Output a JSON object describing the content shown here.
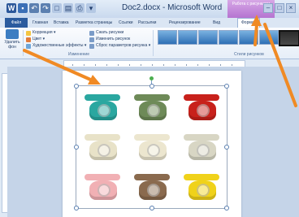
{
  "titlebar": {
    "title": "Doc2.docx - Microsoft Word",
    "context_group": "Работа с рисунками",
    "window_buttons": [
      "–",
      "□",
      "×"
    ]
  },
  "tabs": [
    "Файл",
    "Главная",
    "Вставка",
    "Разметка страницы",
    "Ссылки",
    "Рассылки",
    "Рецензирование",
    "Вид",
    "Формат"
  ],
  "ribbon": {
    "remove_bg_label": "Удалить фон",
    "adjust": {
      "corrections": "Коррекция",
      "color": "Цвет",
      "artistic": "Художественные эффекты",
      "compress": "Сжать рисунки",
      "change": "Изменить рисунок",
      "reset": "Сброс параметров рисунка",
      "group_label": "Изменение"
    },
    "styles": {
      "group_label": "Стили рисунков"
    }
  },
  "colors": {
    "file_tab": "#2b5b9e",
    "context_group": "#b574d1",
    "arrow": "#f08a24",
    "rotate_handle": "#4caf50"
  },
  "phones": [
    {
      "color": "#2aa7a0"
    },
    {
      "color": "#6e8a58"
    },
    {
      "color": "#c8211b"
    },
    {
      "color": "#e8e2c8"
    },
    {
      "color": "#ece6cf"
    },
    {
      "color": "#d8d6c4"
    },
    {
      "color": "#f1b0b4"
    },
    {
      "color": "#8a6a4e"
    },
    {
      "color": "#f0d21a"
    }
  ]
}
